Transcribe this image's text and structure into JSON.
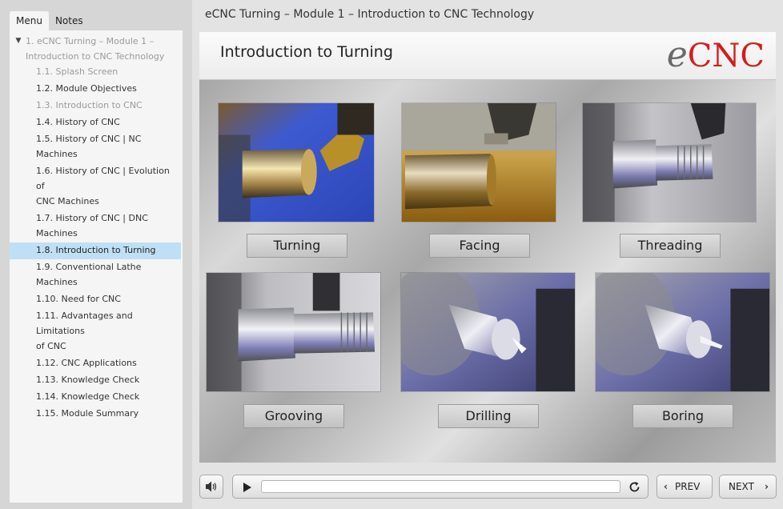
{
  "sidebar": {
    "tabs": [
      {
        "label": "Menu",
        "active": true
      },
      {
        "label": "Notes",
        "active": false
      }
    ],
    "parent_item": {
      "label_line1": "1. eCNC Turning – Module 1 –",
      "label_line2": "Introduction to CNC Technology"
    },
    "items": [
      {
        "label": "1.1. Splash Screen",
        "state": "visited"
      },
      {
        "label": "1.2. Module Objectives",
        "state": "normal"
      },
      {
        "label": "1.3. Introduction to CNC",
        "state": "visited"
      },
      {
        "label": "1.4. History of CNC",
        "state": "normal"
      },
      {
        "label_line1": "1.5. History of CNC | NC",
        "label_line2": "Machines",
        "state": "normal"
      },
      {
        "label_line1": "1.6. History of CNC | Evolution of",
        "label_line2": "CNC Machines",
        "state": "normal"
      },
      {
        "label_line1": "1.7. History of CNC | DNC",
        "label_line2": "Machines",
        "state": "normal"
      },
      {
        "label": "1.8. Introduction to Turning",
        "state": "selected"
      },
      {
        "label": "1.9. Conventional Lathe Machines",
        "state": "normal"
      },
      {
        "label": "1.10. Need for CNC",
        "state": "normal"
      },
      {
        "label_line1": "1.11. Advantages and Limitations",
        "label_line2": "of CNC",
        "state": "normal"
      },
      {
        "label": "1.12. CNC Applications",
        "state": "normal"
      },
      {
        "label": "1.13. Knowledge Check",
        "state": "normal"
      },
      {
        "label": "1.14. Knowledge Check",
        "state": "normal"
      },
      {
        "label": "1.15. Module Summary",
        "state": "normal"
      }
    ]
  },
  "course_title": "eCNC Turning – Module 1 – Introduction to CNC Technology",
  "slide": {
    "title": "Introduction to Turning",
    "logo_e": "e",
    "logo_cnc": "CNC",
    "operations": [
      {
        "label": "Turning",
        "image": "turning-photo"
      },
      {
        "label": "Facing",
        "image": "facing-photo"
      },
      {
        "label": "Threading",
        "image": "threading-photo"
      },
      {
        "label": "Grooving",
        "image": "grooving-photo"
      },
      {
        "label": "Drilling",
        "image": "drilling-photo"
      },
      {
        "label": "Boring",
        "image": "boring-photo"
      }
    ]
  },
  "player": {
    "prev_label": "PREV",
    "next_label": "NEXT",
    "progress": 0,
    "icons": {
      "volume": "speaker-icon",
      "play": "play-icon",
      "replay": "replay-icon",
      "prev": "chevron-left-icon",
      "next": "chevron-right-icon"
    }
  },
  "colors": {
    "logo_red": "#d41c1c",
    "selected_item": "#bfe0f4",
    "visited_text": "#9a9a9a"
  }
}
